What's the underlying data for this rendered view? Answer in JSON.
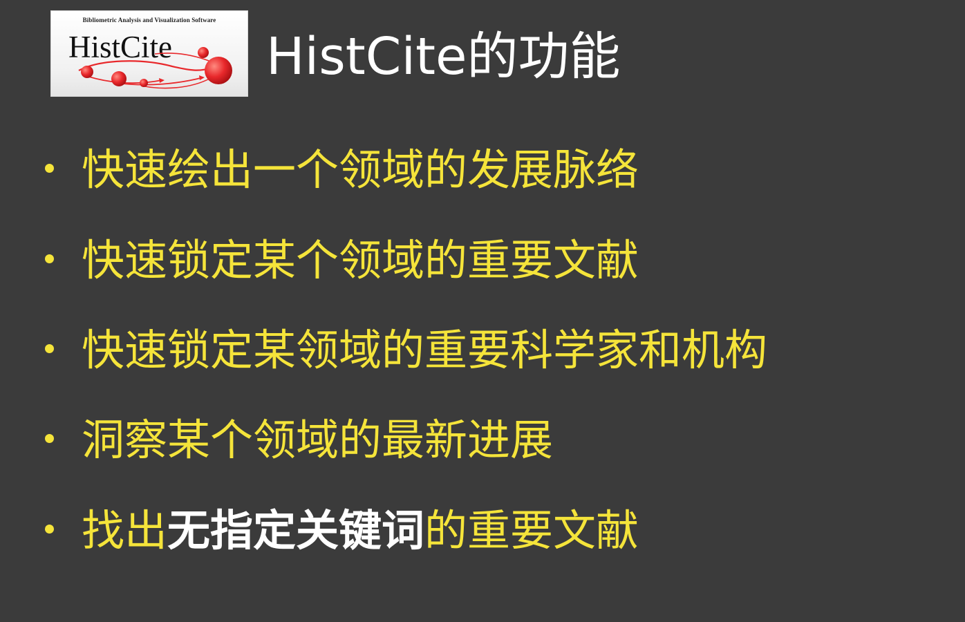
{
  "logo": {
    "tagline": "Bibliometric Analysis and Visualization Software",
    "name": "HistCite"
  },
  "title": "HistCite的功能",
  "bullets": [
    {
      "text": "快速绘出一个领域的发展脉络"
    },
    {
      "text": "快速锁定某个领域的重要文献"
    },
    {
      "text": "快速锁定某领域的重要科学家和机构"
    },
    {
      "text": "洞察某个领域的最新进展"
    },
    {
      "before": "找出",
      "highlight": "无指定关键词",
      "after": "的重要文献"
    }
  ],
  "colors": {
    "background": "#3b3b3b",
    "bullet_text": "#f5e43a",
    "title_text": "#ffffff",
    "highlight_text": "#ffffff",
    "logo_red": "#e8282b"
  }
}
